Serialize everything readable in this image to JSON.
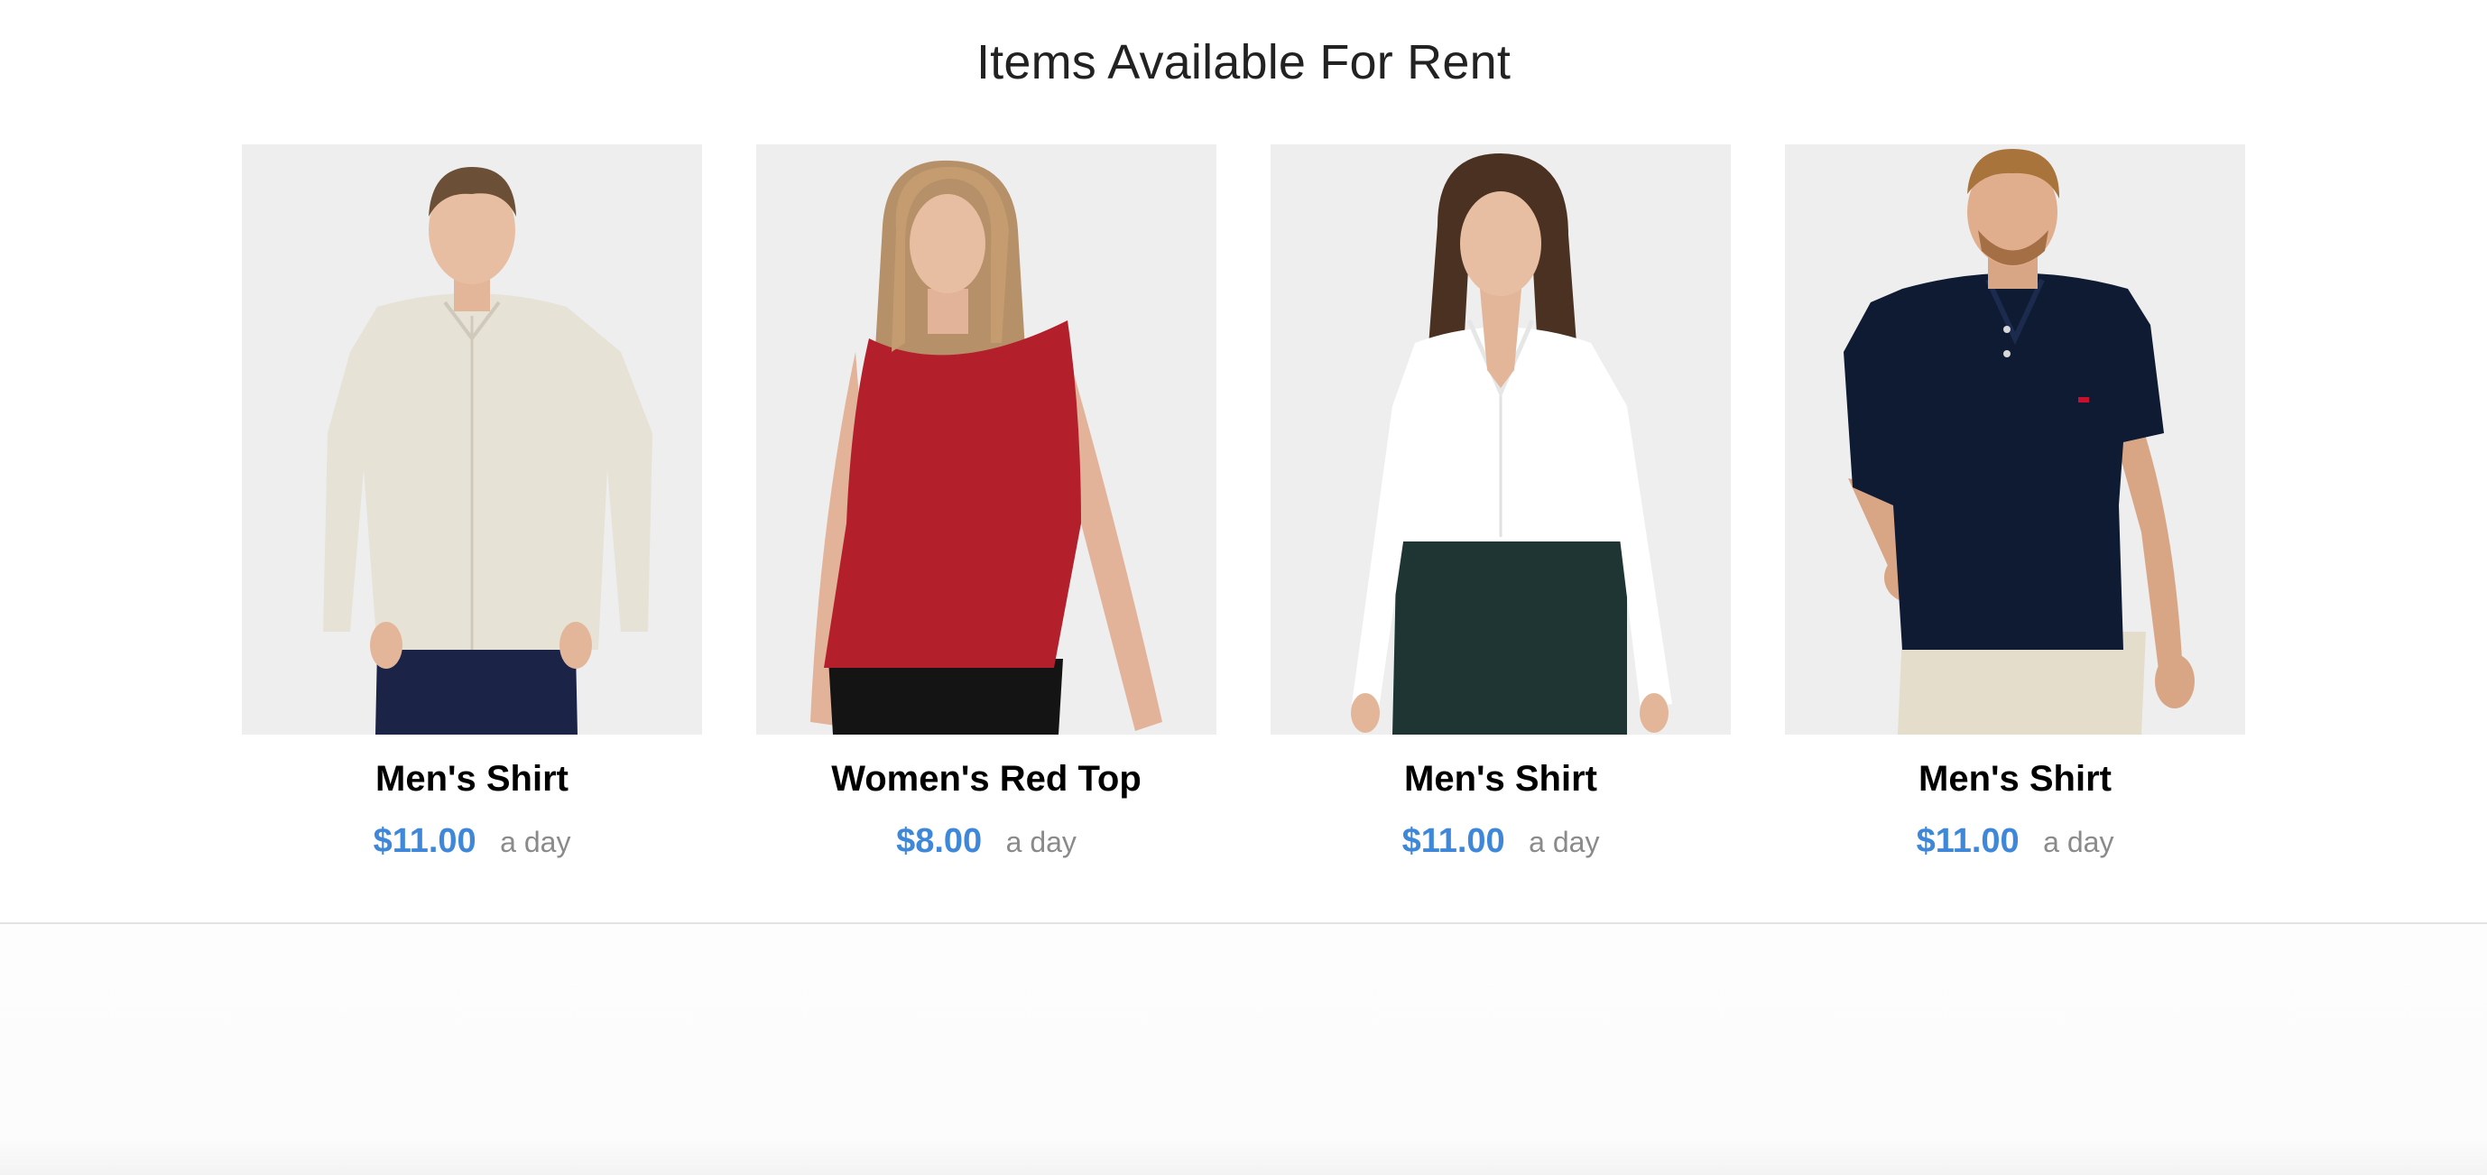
{
  "page": {
    "title": "Items Available For Rent"
  },
  "items": [
    {
      "name": "Men's Shirt",
      "price": "$11.00",
      "unit": "a day",
      "photo_icon": "man-in-beige-linen-shirt-photo",
      "garment_color": "#e7e2d6"
    },
    {
      "name": "Women's Red Top",
      "price": "$8.00",
      "unit": "a day",
      "photo_icon": "woman-in-red-sleeveless-top-photo",
      "garment_color": "#b3202b"
    },
    {
      "name": "Men's Shirt",
      "price": "$11.00",
      "unit": "a day",
      "photo_icon": "woman-in-white-shirt-photo",
      "garment_color": "#ffffff"
    },
    {
      "name": "Men's Shirt",
      "price": "$11.00",
      "unit": "a day",
      "photo_icon": "man-in-navy-polo-photo",
      "garment_color": "#0f1a33"
    }
  ],
  "colors": {
    "price": "#3f87d9",
    "unit": "#8a8a8a",
    "photo_background": "#eeeeef"
  }
}
